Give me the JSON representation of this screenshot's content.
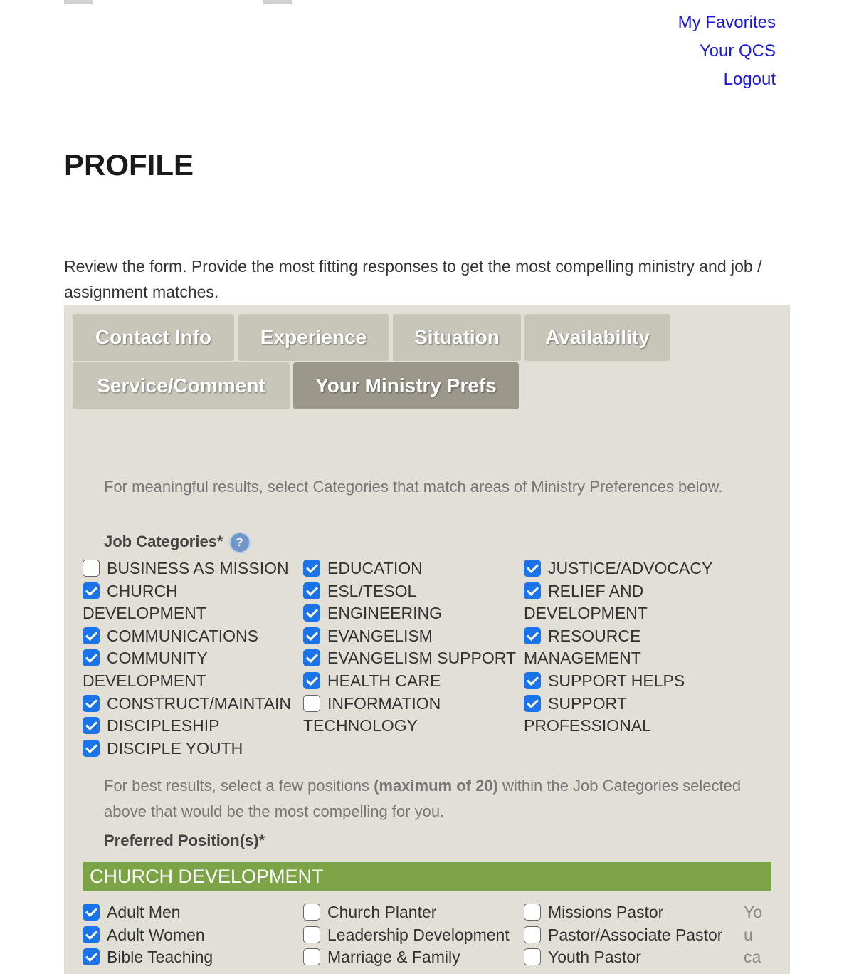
{
  "top_links": [
    "My Favorites",
    "Your QCS",
    "Logout"
  ],
  "page_title": "PROFILE",
  "intro": "Review the form. Provide the most fitting responses to get the most compelling ministry and job / assignment matches.",
  "tabs": [
    {
      "label": "Contact Info",
      "active": false
    },
    {
      "label": "Experience",
      "active": false
    },
    {
      "label": "Situation",
      "active": false
    },
    {
      "label": "Availability",
      "active": false
    },
    {
      "label": "Service/Comment",
      "active": false
    },
    {
      "label": "Your Ministry Prefs",
      "active": true
    }
  ],
  "categories_hint": "For meaningful results, select Categories that match areas of Ministry Preferences below.",
  "job_categories_label": "Job Categories*",
  "help_icon": "?",
  "job_categories": [
    [
      {
        "label": "BUSINESS AS MISSION",
        "checked": false
      },
      {
        "label": "CHURCH DEVELOPMENT",
        "checked": true
      },
      {
        "label": "COMMUNICATIONS",
        "checked": true
      },
      {
        "label": "COMMUNITY DEVELOPMENT",
        "checked": true
      },
      {
        "label": "CONSTRUCT/MAINTAIN",
        "checked": true
      },
      {
        "label": "DISCIPLESHIP",
        "checked": true
      },
      {
        "label": "DISCIPLE YOUTH",
        "checked": true
      }
    ],
    [
      {
        "label": "EDUCATION",
        "checked": true
      },
      {
        "label": "ESL/TESOL",
        "checked": true
      },
      {
        "label": "ENGINEERING",
        "checked": true
      },
      {
        "label": "EVANGELISM",
        "checked": true
      },
      {
        "label": "EVANGELISM SUPPORT",
        "checked": true
      },
      {
        "label": "HEALTH CARE",
        "checked": true
      },
      {
        "label": "INFORMATION TECHNOLOGY",
        "checked": false
      }
    ],
    [
      {
        "label": "JUSTICE/ADVOCACY",
        "checked": true
      },
      {
        "label": "RELIEF AND DEVELOPMENT",
        "checked": true
      },
      {
        "label": "RESOURCE MANAGEMENT",
        "checked": true
      },
      {
        "label": "SUPPORT HELPS",
        "checked": true
      },
      {
        "label": "SUPPORT PROFESSIONAL",
        "checked": true
      }
    ]
  ],
  "positions_hint": {
    "before": "For best results, select a few positions ",
    "bold": "(maximum of 20)",
    "after": " within the Job Categories selected above that would be the most compelling for you."
  },
  "preferred_positions_label": "Preferred Position(s)*",
  "section_title": "CHURCH DEVELOPMENT",
  "positions": [
    [
      {
        "label": "Adult Men",
        "checked": true
      },
      {
        "label": "Adult Women",
        "checked": true
      },
      {
        "label": "Bible Teaching",
        "checked": true
      }
    ],
    [
      {
        "label": "Church Planter",
        "checked": false
      },
      {
        "label": "Leadership Development",
        "checked": false
      },
      {
        "label": "Marriage & Family",
        "checked": false
      }
    ],
    [
      {
        "label": "Missions Pastor",
        "checked": false
      },
      {
        "label": "Pastor/Associate Pastor",
        "checked": false
      },
      {
        "label": "Youth Pastor",
        "checked": false
      }
    ]
  ],
  "trailing_text": [
    "Yo",
    "u",
    "ca"
  ]
}
